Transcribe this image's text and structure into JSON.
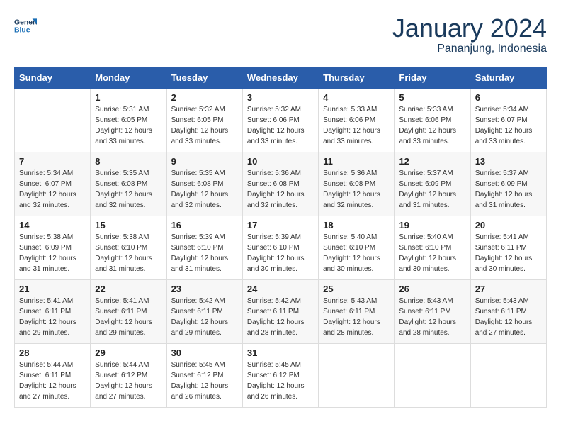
{
  "header": {
    "logo_general": "General",
    "logo_blue": "Blue",
    "month": "January 2024",
    "location": "Pananjung, Indonesia"
  },
  "days_of_week": [
    "Sunday",
    "Monday",
    "Tuesday",
    "Wednesday",
    "Thursday",
    "Friday",
    "Saturday"
  ],
  "weeks": [
    [
      {
        "day": "",
        "info": ""
      },
      {
        "day": "1",
        "info": "Sunrise: 5:31 AM\nSunset: 6:05 PM\nDaylight: 12 hours\nand 33 minutes."
      },
      {
        "day": "2",
        "info": "Sunrise: 5:32 AM\nSunset: 6:05 PM\nDaylight: 12 hours\nand 33 minutes."
      },
      {
        "day": "3",
        "info": "Sunrise: 5:32 AM\nSunset: 6:06 PM\nDaylight: 12 hours\nand 33 minutes."
      },
      {
        "day": "4",
        "info": "Sunrise: 5:33 AM\nSunset: 6:06 PM\nDaylight: 12 hours\nand 33 minutes."
      },
      {
        "day": "5",
        "info": "Sunrise: 5:33 AM\nSunset: 6:06 PM\nDaylight: 12 hours\nand 33 minutes."
      },
      {
        "day": "6",
        "info": "Sunrise: 5:34 AM\nSunset: 6:07 PM\nDaylight: 12 hours\nand 33 minutes."
      }
    ],
    [
      {
        "day": "7",
        "info": "Sunrise: 5:34 AM\nSunset: 6:07 PM\nDaylight: 12 hours\nand 32 minutes."
      },
      {
        "day": "8",
        "info": "Sunrise: 5:35 AM\nSunset: 6:08 PM\nDaylight: 12 hours\nand 32 minutes."
      },
      {
        "day": "9",
        "info": "Sunrise: 5:35 AM\nSunset: 6:08 PM\nDaylight: 12 hours\nand 32 minutes."
      },
      {
        "day": "10",
        "info": "Sunrise: 5:36 AM\nSunset: 6:08 PM\nDaylight: 12 hours\nand 32 minutes."
      },
      {
        "day": "11",
        "info": "Sunrise: 5:36 AM\nSunset: 6:08 PM\nDaylight: 12 hours\nand 32 minutes."
      },
      {
        "day": "12",
        "info": "Sunrise: 5:37 AM\nSunset: 6:09 PM\nDaylight: 12 hours\nand 31 minutes."
      },
      {
        "day": "13",
        "info": "Sunrise: 5:37 AM\nSunset: 6:09 PM\nDaylight: 12 hours\nand 31 minutes."
      }
    ],
    [
      {
        "day": "14",
        "info": "Sunrise: 5:38 AM\nSunset: 6:09 PM\nDaylight: 12 hours\nand 31 minutes."
      },
      {
        "day": "15",
        "info": "Sunrise: 5:38 AM\nSunset: 6:10 PM\nDaylight: 12 hours\nand 31 minutes."
      },
      {
        "day": "16",
        "info": "Sunrise: 5:39 AM\nSunset: 6:10 PM\nDaylight: 12 hours\nand 31 minutes."
      },
      {
        "day": "17",
        "info": "Sunrise: 5:39 AM\nSunset: 6:10 PM\nDaylight: 12 hours\nand 30 minutes."
      },
      {
        "day": "18",
        "info": "Sunrise: 5:40 AM\nSunset: 6:10 PM\nDaylight: 12 hours\nand 30 minutes."
      },
      {
        "day": "19",
        "info": "Sunrise: 5:40 AM\nSunset: 6:10 PM\nDaylight: 12 hours\nand 30 minutes."
      },
      {
        "day": "20",
        "info": "Sunrise: 5:41 AM\nSunset: 6:11 PM\nDaylight: 12 hours\nand 30 minutes."
      }
    ],
    [
      {
        "day": "21",
        "info": "Sunrise: 5:41 AM\nSunset: 6:11 PM\nDaylight: 12 hours\nand 29 minutes."
      },
      {
        "day": "22",
        "info": "Sunrise: 5:41 AM\nSunset: 6:11 PM\nDaylight: 12 hours\nand 29 minutes."
      },
      {
        "day": "23",
        "info": "Sunrise: 5:42 AM\nSunset: 6:11 PM\nDaylight: 12 hours\nand 29 minutes."
      },
      {
        "day": "24",
        "info": "Sunrise: 5:42 AM\nSunset: 6:11 PM\nDaylight: 12 hours\nand 28 minutes."
      },
      {
        "day": "25",
        "info": "Sunrise: 5:43 AM\nSunset: 6:11 PM\nDaylight: 12 hours\nand 28 minutes."
      },
      {
        "day": "26",
        "info": "Sunrise: 5:43 AM\nSunset: 6:11 PM\nDaylight: 12 hours\nand 28 minutes."
      },
      {
        "day": "27",
        "info": "Sunrise: 5:43 AM\nSunset: 6:11 PM\nDaylight: 12 hours\nand 27 minutes."
      }
    ],
    [
      {
        "day": "28",
        "info": "Sunrise: 5:44 AM\nSunset: 6:11 PM\nDaylight: 12 hours\nand 27 minutes."
      },
      {
        "day": "29",
        "info": "Sunrise: 5:44 AM\nSunset: 6:12 PM\nDaylight: 12 hours\nand 27 minutes."
      },
      {
        "day": "30",
        "info": "Sunrise: 5:45 AM\nSunset: 6:12 PM\nDaylight: 12 hours\nand 26 minutes."
      },
      {
        "day": "31",
        "info": "Sunrise: 5:45 AM\nSunset: 6:12 PM\nDaylight: 12 hours\nand 26 minutes."
      },
      {
        "day": "",
        "info": ""
      },
      {
        "day": "",
        "info": ""
      },
      {
        "day": "",
        "info": ""
      }
    ]
  ]
}
